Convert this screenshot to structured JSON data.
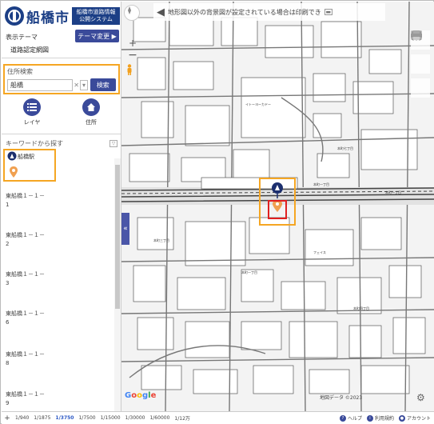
{
  "app": {
    "city_name": "船橋市",
    "system_name_line1": "船橋市道路情報",
    "system_name_line2": "公開システム"
  },
  "theme": {
    "label": "表示テーマ",
    "change_button": "テーマ変更 ▶",
    "current": "道路認定網図"
  },
  "search": {
    "label": "住所検索",
    "value": "船橋",
    "button": "検索"
  },
  "actions": [
    {
      "label": "レイヤ",
      "icon": "list-icon"
    },
    {
      "label": "住所",
      "icon": "home-icon"
    }
  ],
  "keyword": {
    "label": "キーワードから探す"
  },
  "results": [
    {
      "label": "船橋駅",
      "highlighted": true
    },
    {
      "label": "東船橋１－１－\n1"
    },
    {
      "label": "東船橋１－１－\n2"
    },
    {
      "label": "東船橋１－１－\n3"
    },
    {
      "label": "東船橋１－１－\n6"
    },
    {
      "label": "東船橋１－１－\n8"
    },
    {
      "label": "東船橋１－１－\n9"
    }
  ],
  "map": {
    "notice": "地形図以外の背景図が設定されている場合は印刷でき",
    "google_label": "Google",
    "copyright": "地図データ ©2023",
    "colors": {
      "accent": "#3a4a9a",
      "highlight": "#f5a623",
      "marker_red": "#e02020",
      "pin_orange": "#f0a050"
    }
  },
  "footer": {
    "scales": [
      "1/940",
      "1/1875",
      "1/3750",
      "1/7500",
      "1/15000",
      "1/30000",
      "1/60000",
      "1/12万"
    ],
    "active_scale": "1/3750",
    "links": [
      "ヘルプ",
      "利用規約",
      "アカウント"
    ]
  }
}
